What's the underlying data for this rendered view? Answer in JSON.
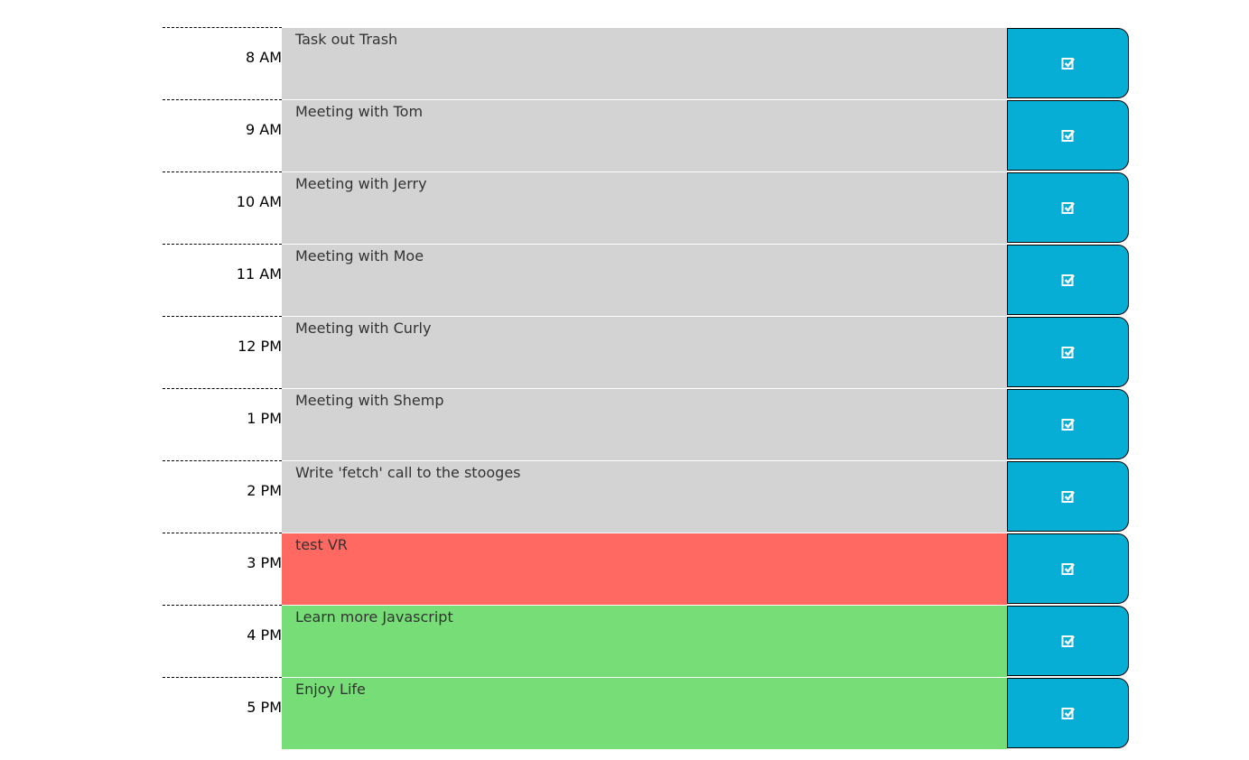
{
  "colors": {
    "past": "#d3d3d3",
    "present": "#ff6961",
    "future": "#77dd77",
    "save": "#06aed5"
  },
  "rows": [
    {
      "hour": "8 AM",
      "text": "Task out Trash",
      "state": "past",
      "icon": "save-check-icon"
    },
    {
      "hour": "9 AM",
      "text": "Meeting with Tom",
      "state": "past",
      "icon": "save-check-icon"
    },
    {
      "hour": "10 AM",
      "text": "Meeting with Jerry",
      "state": "past",
      "icon": "save-check-icon"
    },
    {
      "hour": "11 AM",
      "text": "Meeting with Moe",
      "state": "past",
      "icon": "save-check-icon"
    },
    {
      "hour": "12 PM",
      "text": "Meeting with Curly",
      "state": "past",
      "icon": "save-check-icon"
    },
    {
      "hour": "1 PM",
      "text": "Meeting with Shemp",
      "state": "past",
      "icon": "save-check-icon"
    },
    {
      "hour": "2 PM",
      "text": "Write 'fetch' call to the stooges",
      "state": "past",
      "icon": "save-check-icon"
    },
    {
      "hour": "3 PM",
      "text": "test VR",
      "state": "present",
      "icon": "save-check-icon"
    },
    {
      "hour": "4 PM",
      "text": "Learn more Javascript",
      "state": "future",
      "icon": "save-check-icon"
    },
    {
      "hour": "5 PM",
      "text": "Enjoy Life",
      "state": "future",
      "icon": "save-check-icon"
    }
  ]
}
